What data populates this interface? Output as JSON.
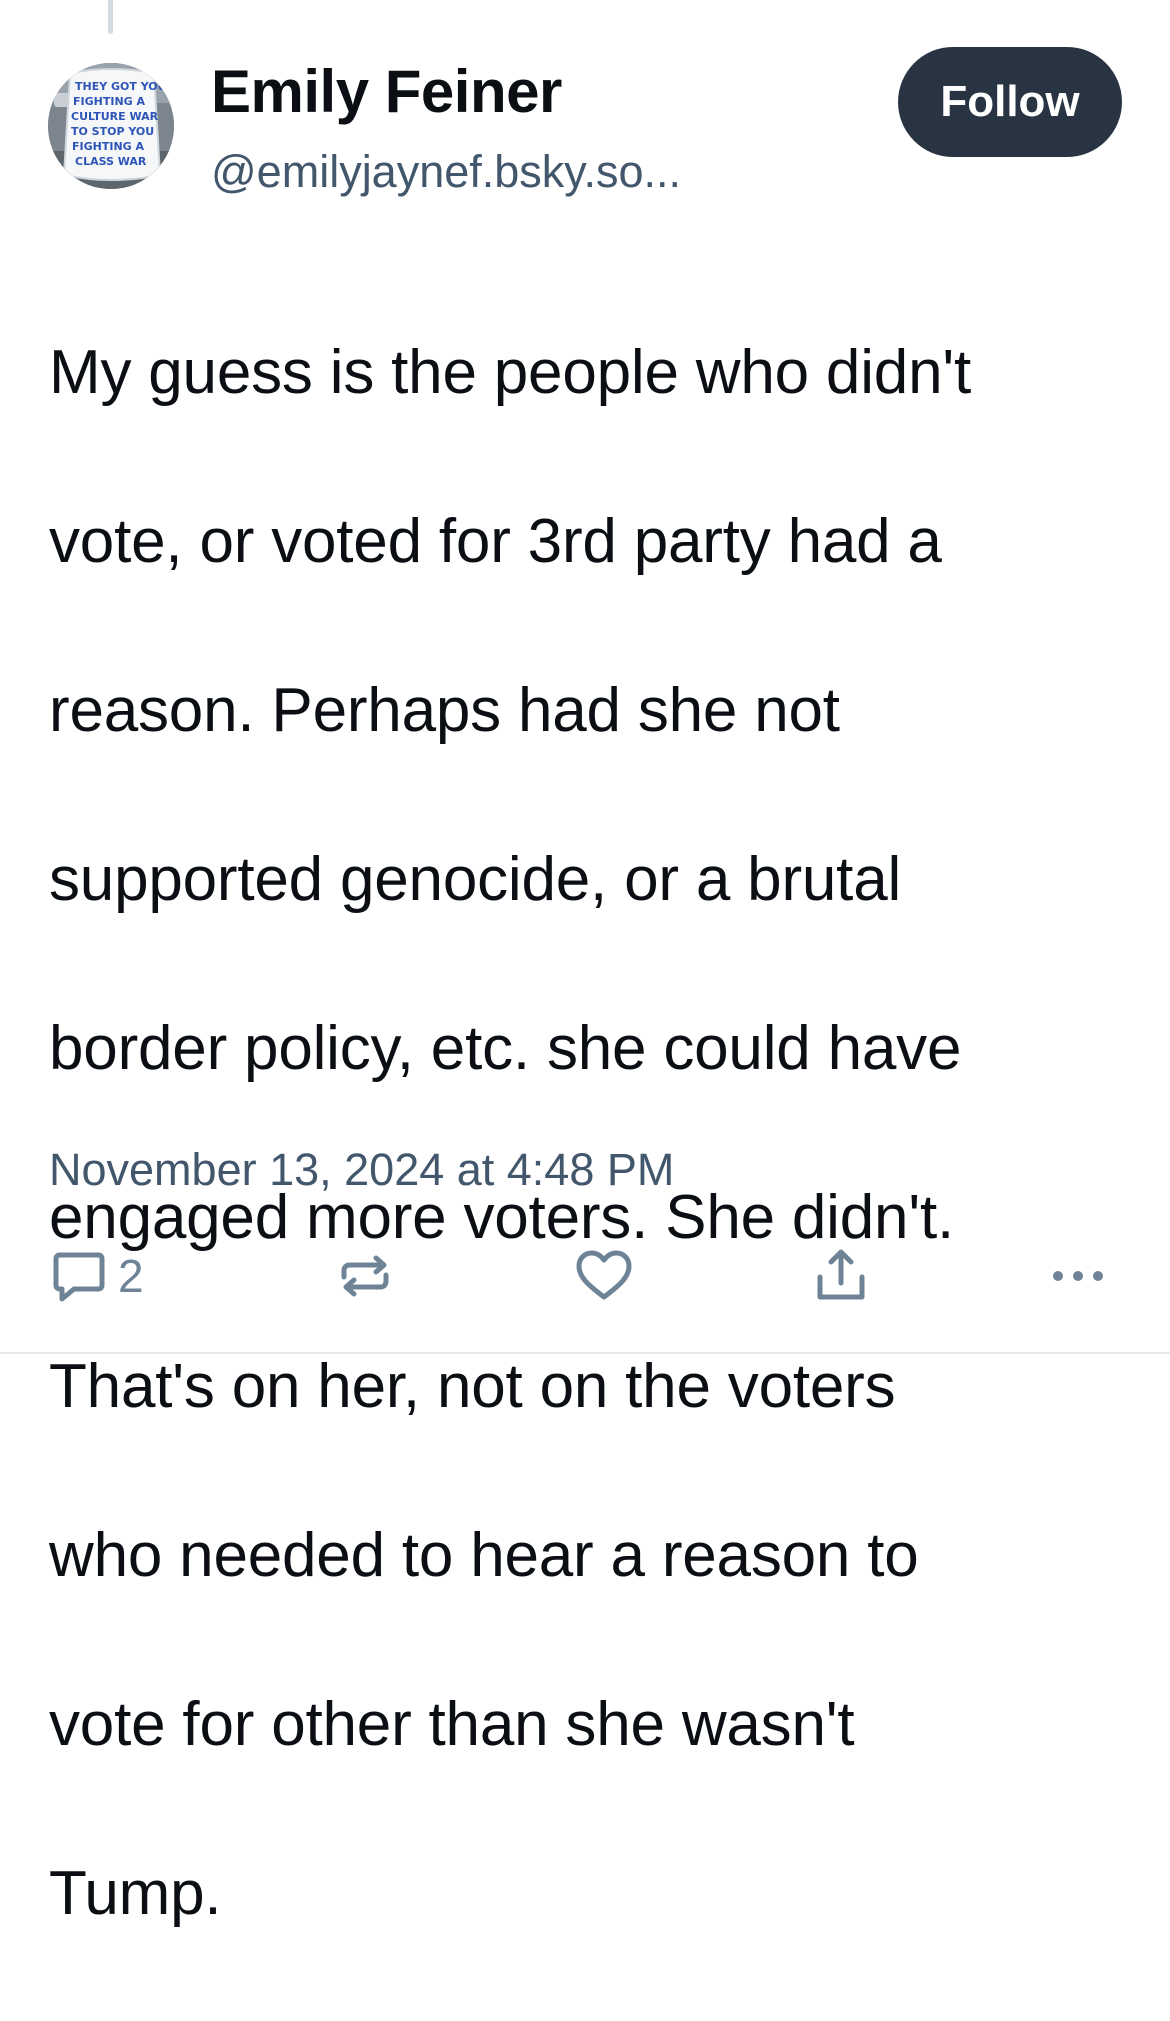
{
  "post": {
    "author": {
      "display_name": "Emily Feiner",
      "handle": "@emilyjaynef.bsky.so...",
      "avatar_icon": "avatar-image",
      "avatar_text": [
        "THEY GOT YOU",
        "FIGHTING A",
        "CULTURE WAR",
        "TO STOP YOU",
        "FIGHTING A",
        "CLASS WAR"
      ]
    },
    "follow_label": "Follow",
    "body_lines": [
      "My guess is the people who didn't",
      "vote, or voted for 3rd party had a",
      "reason. Perhaps had she not",
      "supported genocide, or a brutal",
      "border policy, etc. she could have",
      "engaged more voters. She didn't.",
      "That's on her, not on the voters",
      "who needed to hear a reason to",
      "vote for other than she wasn't",
      "Tump."
    ],
    "timestamp": "November 13, 2024 at 4:48 PM",
    "actions": {
      "reply_icon": "reply-bubble-icon",
      "reply_count": "2",
      "repost_icon": "repost-icon",
      "like_icon": "heart-icon",
      "share_icon": "share-icon",
      "more_icon": "more-dots-icon"
    }
  },
  "colors": {
    "text_primary": "#0b0f14",
    "text_secondary": "#42576c",
    "icon": "#6f8396",
    "follow_bg": "#283442",
    "follow_text": "#ffffff",
    "thread_line": "#d4dbe2"
  }
}
